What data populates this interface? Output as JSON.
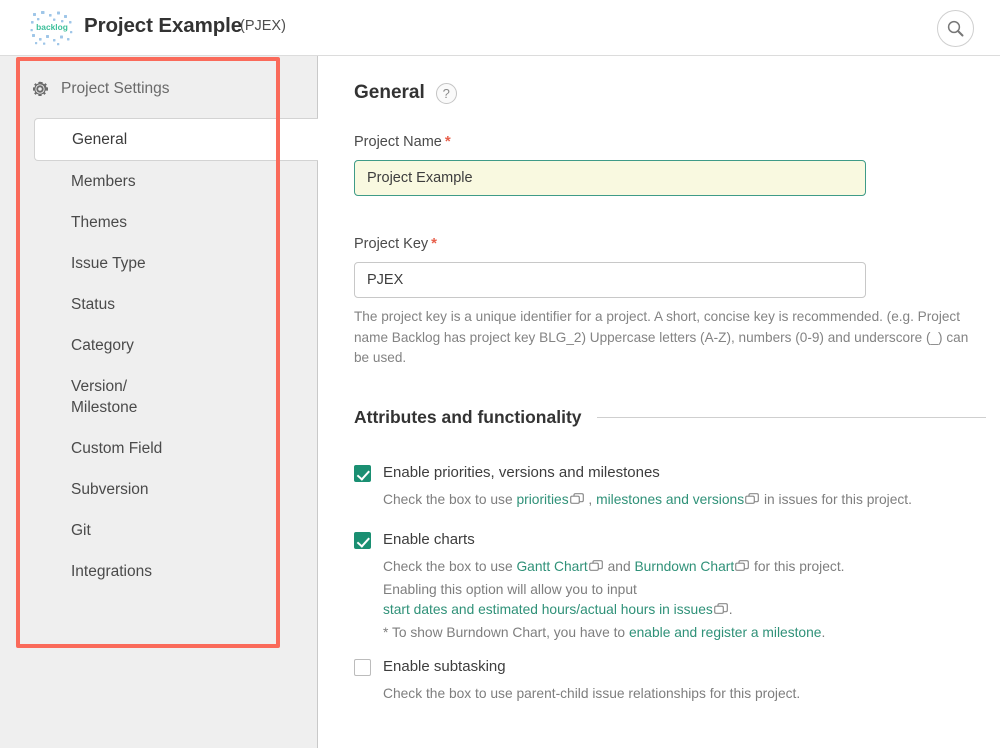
{
  "header": {
    "logo_text": "backlog",
    "logo_name": "backlog-logo",
    "project_title": "Project Example",
    "project_key_display": "(PJEX)",
    "search_icon": "search-icon"
  },
  "sidebar": {
    "heading": "Project Settings",
    "gear_icon": "gear-icon",
    "items": [
      {
        "label": "General",
        "active": true
      },
      {
        "label": "Members",
        "active": false
      },
      {
        "label": "Themes",
        "active": false
      },
      {
        "label": "Issue Type",
        "active": false
      },
      {
        "label": "Status",
        "active": false
      },
      {
        "label": "Category",
        "active": false
      },
      {
        "label": "Version/\nMilestone",
        "active": false
      },
      {
        "label": "Custom Field",
        "active": false
      },
      {
        "label": "Subversion",
        "active": false
      },
      {
        "label": "Git",
        "active": false
      },
      {
        "label": "Integrations",
        "active": false
      }
    ]
  },
  "main": {
    "section_title": "General",
    "help_badge": "?",
    "project_name": {
      "label": "Project Name",
      "required_mark": "*",
      "value": "Project Example"
    },
    "project_key": {
      "label": "Project Key",
      "required_mark": "*",
      "value": "PJEX",
      "hint": "The project key is a unique identifier for a project. A short, concise key is recommended. (e.g. Project name Backlog has project key BLG_2) Uppercase letters (A-Z), numbers (0-9) and underscore (_) can be used."
    },
    "attributes_heading": "Attributes and functionality",
    "options": {
      "priorities": {
        "label": "Enable priorities, versions and milestones",
        "checked": true,
        "desc_part1": "Check the box to use ",
        "link1": "priorities",
        "desc_part2": " , ",
        "link2": "milestones and versions",
        "desc_part3": " in issues for this project."
      },
      "charts": {
        "label": "Enable charts",
        "checked": true,
        "desc_part1": "Check the box to use ",
        "link1": "Gantt Chart",
        "desc_part2": " and ",
        "link2": "Burndown Chart",
        "desc_part3": " for this project.",
        "line2": "Enabling this option will allow you to input",
        "link3": "start dates and estimated hours/actual hours in issues",
        "line3_tail": ".",
        "line4_prefix": "* To show Burndown Chart, you have to ",
        "link4": "enable and register a milestone",
        "line4_tail": "."
      },
      "subtasking": {
        "label": "Enable subtasking",
        "checked": false,
        "desc": "Check the box to use parent-child issue relationships for this project."
      }
    }
  },
  "colors": {
    "accent_green": "#1a8f72",
    "link_green": "#2f9178",
    "annotation_red": "#fa6a5a",
    "required_star": "#e8604c",
    "sidebar_bg": "#efefef",
    "focused_input_bg": "#f9f9e0"
  }
}
